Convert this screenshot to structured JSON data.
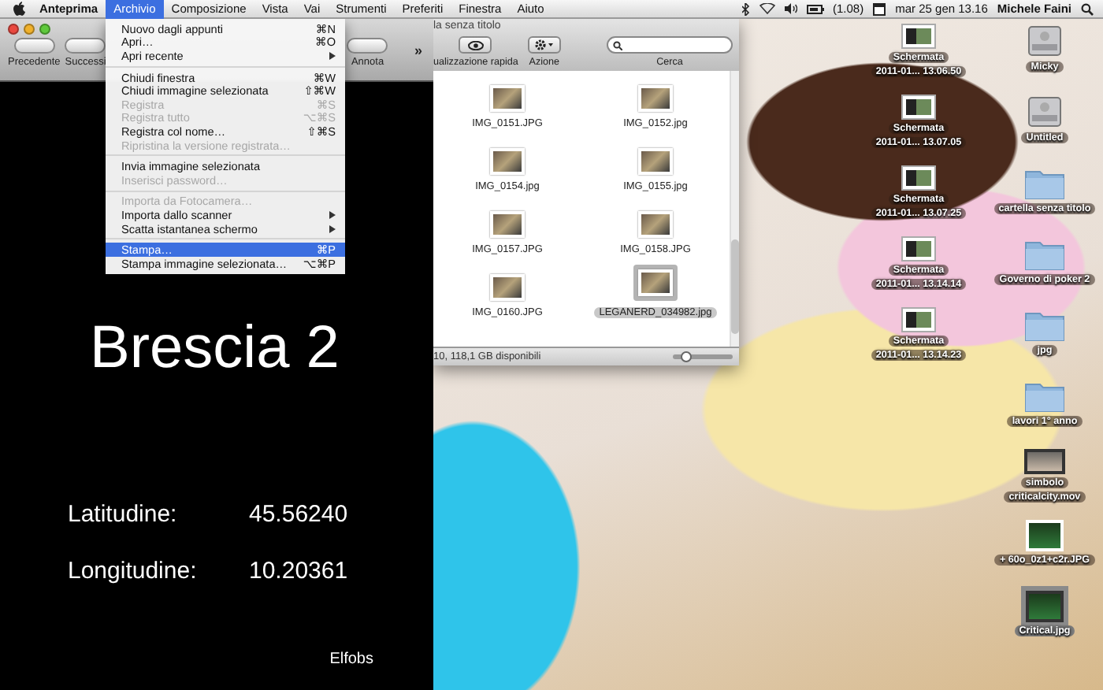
{
  "menu_bar": {
    "app": "Anteprima",
    "menus": [
      {
        "label": "Archivio",
        "selected": true
      },
      {
        "label": "Composizione",
        "selected": false
      },
      {
        "label": "Vista",
        "selected": false
      },
      {
        "label": "Vai",
        "selected": false
      },
      {
        "label": "Strumenti",
        "selected": false
      },
      {
        "label": "Preferiti",
        "selected": false
      },
      {
        "label": "Finestra",
        "selected": false
      },
      {
        "label": "Aiuto",
        "selected": false
      }
    ],
    "battery_reading": "(1.08)",
    "clock": "mar 25 gen 13.16",
    "user": "Michele Faini"
  },
  "open_menu": {
    "items": [
      {
        "kind": "item",
        "label": "Nuovo dagli appunti",
        "shortcut": "⌘N",
        "disabled": false,
        "selected": false,
        "submenu": false
      },
      {
        "kind": "item",
        "label": "Apri…",
        "shortcut": "⌘O",
        "disabled": false,
        "selected": false,
        "submenu": false
      },
      {
        "kind": "item",
        "label": "Apri recente",
        "disabled": false,
        "selected": false,
        "submenu": true
      },
      {
        "kind": "separator"
      },
      {
        "kind": "item",
        "label": "Chiudi finestra",
        "shortcut": "⌘W",
        "disabled": false,
        "selected": false,
        "submenu": false
      },
      {
        "kind": "item",
        "label": "Chiudi immagine selezionata",
        "shortcut": "⇧⌘W",
        "disabled": false,
        "selected": false,
        "submenu": false
      },
      {
        "kind": "item",
        "label": "Registra",
        "shortcut": "⌘S",
        "disabled": true,
        "selected": false,
        "submenu": false
      },
      {
        "kind": "item",
        "label": "Registra tutto",
        "shortcut": "⌥⌘S",
        "disabled": true,
        "selected": false,
        "submenu": false
      },
      {
        "kind": "item",
        "label": "Registra col nome…",
        "shortcut": "⇧⌘S",
        "disabled": false,
        "selected": false,
        "submenu": false
      },
      {
        "kind": "item",
        "label": "Ripristina la versione registrata…",
        "disabled": true,
        "selected": false,
        "submenu": false
      },
      {
        "kind": "separator"
      },
      {
        "kind": "item",
        "label": "Invia immagine selezionata",
        "disabled": false,
        "selected": false,
        "submenu": false
      },
      {
        "kind": "item",
        "label": "Inserisci password…",
        "disabled": true,
        "selected": false,
        "submenu": false
      },
      {
        "kind": "separator"
      },
      {
        "kind": "item",
        "label": "Importa da Fotocamera…",
        "disabled": true,
        "selected": false,
        "submenu": false
      },
      {
        "kind": "item",
        "label": "Importa dallo scanner",
        "disabled": false,
        "selected": false,
        "submenu": true
      },
      {
        "kind": "item",
        "label": "Scatta istantanea schermo",
        "disabled": false,
        "selected": false,
        "submenu": true
      },
      {
        "kind": "separator"
      },
      {
        "kind": "item",
        "label": "Stampa…",
        "shortcut": "⌘P",
        "disabled": false,
        "selected": true,
        "submenu": false
      },
      {
        "kind": "item",
        "label": "Stampa immagine selezionata…",
        "shortcut": "⌥⌘P",
        "disabled": false,
        "selected": false,
        "submenu": false
      }
    ]
  },
  "preview_window": {
    "toolbar": [
      "Precedente",
      "Successi",
      "Annota"
    ],
    "more": "»",
    "title": "Brescia 2",
    "fields": [
      {
        "label": "Latitudine:",
        "value": "45.56240"
      },
      {
        "label": "Longitudine:",
        "value": "10.20361"
      }
    ],
    "footer": "Elfobs"
  },
  "finder_window": {
    "title": "la senza titolo",
    "toolbar": [
      "ualizzazione rapida",
      "Azione"
    ],
    "search": {
      "label": "Cerca"
    },
    "files": [
      {
        "name": "IMG_0151.JPG",
        "selected": false
      },
      {
        "name": "IMG_0152.jpg",
        "selected": false
      },
      {
        "name": "IMG_0154.jpg",
        "selected": false
      },
      {
        "name": "IMG_0155.jpg",
        "selected": false
      },
      {
        "name": "IMG_0157.JPG",
        "selected": false
      },
      {
        "name": "IMG_0158.JPG",
        "selected": false
      },
      {
        "name": "IMG_0160.JPG",
        "selected": false
      },
      {
        "name": "LEGANERD_034982.jpg",
        "selected": true
      }
    ],
    "status": "10, 118,1 GB disponibili",
    "zoom_slider": {
      "level": 0.2
    }
  },
  "desktop": {
    "columns": [
      [
        {
          "kind": "screenshot",
          "lines": [
            "Schermata",
            "2011-01... 13.06.50"
          ],
          "selected": false
        },
        {
          "kind": "screenshot",
          "lines": [
            "Schermata",
            "2011-01... 13.07.05"
          ],
          "selected": false
        },
        {
          "kind": "screenshot",
          "lines": [
            "Schermata",
            "2011-01... 13.07.25"
          ],
          "selected": false
        },
        {
          "kind": "screenshot",
          "lines": [
            "Schermata",
            "2011-01... 13.14.14"
          ],
          "selected": false
        },
        {
          "kind": "screenshot",
          "lines": [
            "Schermata",
            "2011-01... 13.14.23"
          ],
          "selected": false
        }
      ],
      [
        {
          "kind": "drive",
          "lines": [
            "Micky"
          ],
          "selected": false
        },
        {
          "kind": "drive",
          "lines": [
            "Untitled"
          ],
          "selected": false
        },
        {
          "kind": "folder",
          "lines": [
            "cartella senza titolo"
          ],
          "selected": false
        },
        {
          "kind": "folder",
          "lines": [
            "Governo di poker 2"
          ],
          "selected": false
        },
        {
          "kind": "folder",
          "lines": [
            "jpg"
          ],
          "selected": false
        },
        {
          "kind": "folder",
          "lines": [
            "lavori 1° anno"
          ],
          "selected": false
        },
        {
          "kind": "video",
          "lines": [
            "simbolo",
            "criticalcity.mov"
          ],
          "selected": false
        },
        {
          "kind": "image",
          "lines": [
            "+ 60o_0z1+c2r.JPG"
          ],
          "selected": false
        },
        {
          "kind": "image",
          "lines": [
            "Critical.jpg"
          ],
          "selected": true
        }
      ]
    ]
  }
}
